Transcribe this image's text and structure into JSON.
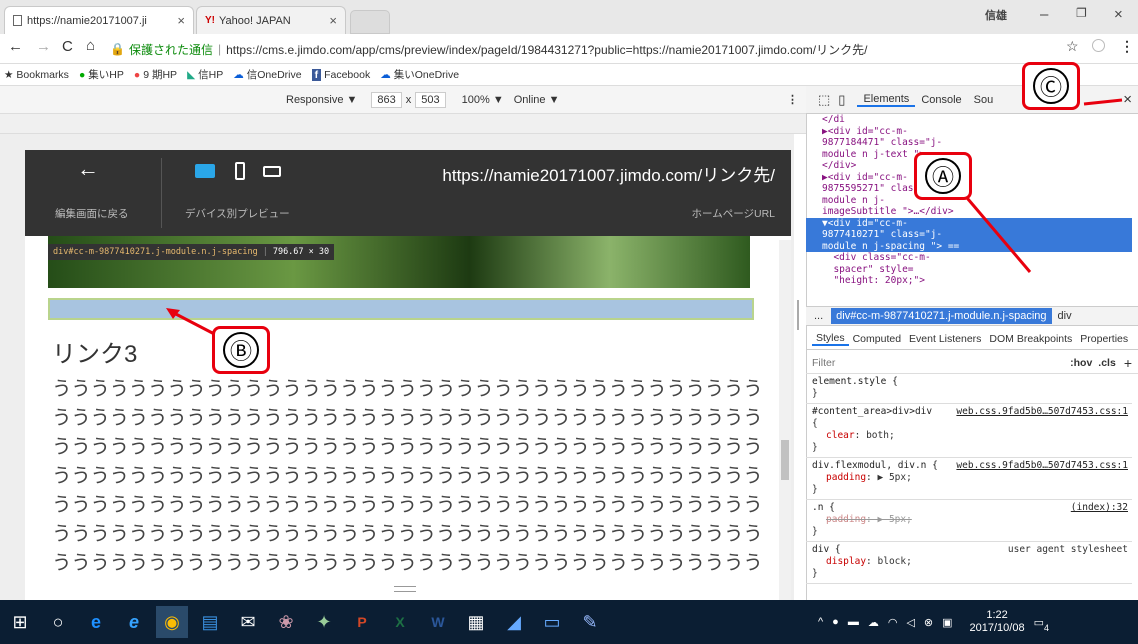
{
  "browser": {
    "tabs": [
      {
        "title": "https://namie20171007.ji",
        "favicon": "page-icon"
      },
      {
        "title": "Yahoo! JAPAN",
        "favicon": "yahoo-icon"
      }
    ],
    "window_user": "信雄",
    "security_label": "保護された通信",
    "url": "https://cms.e.jimdo.com/app/cms/preview/index/pageId/1984431271?public=https://namie20171007.jimdo.com/リンク先/"
  },
  "bookmarks": [
    "Bookmarks",
    "集いHP",
    "9 期HP",
    "信HP",
    "信OneDrive",
    "Facebook",
    "集いOneDrive"
  ],
  "device_toolbar": {
    "mode": "Responsive ▼",
    "width": "863",
    "times": "x",
    "height": "503",
    "zoom": "100% ▼",
    "network": "Online ▼"
  },
  "jimdo_header": {
    "back_label": "編集画面に戻る",
    "preview_label": "デバイス別プレビュー",
    "url": "https://namie20171007.jimdo.com/リンク先/",
    "url_label": "ホームページURL"
  },
  "inspect_tooltip": {
    "selector": "div#cc-m-9877410271.j-module.n.j-spacing",
    "size": "796.67 × 30"
  },
  "page": {
    "heading": "リンク3",
    "lines": [
      "ううううううううううううううううううううううううううううううううううううう",
      "ううううううううううううううううううううううううううううううううううううう",
      "ううううううううううううううううううううううううううううううううううううう",
      "ううううううううううううううううううううううううううううううううううううう",
      "ううううううううううううううううううううううううううううううううううううう",
      "ううううううううううううううううううううううううううううううううううううう",
      "ううううううううううううううううううううううううううううううううううううう"
    ]
  },
  "devtools": {
    "tabs": [
      "Elements",
      "Console",
      "Sou"
    ],
    "dom_lines": [
      "</di",
      "▶<div id=\"cc-m-",
      "9877184471\" class=\"j-",
      "module n j-text \">…",
      "</div>",
      "▶<div id=\"cc-m-",
      "9875595271\" class=\"j-",
      "module n j-",
      "imageSubtitle \">…</div>",
      "▼<div id=\"cc-m-",
      "9877410271\" class=\"j-",
      "module n j-spacing \"> ==",
      "  <div class=\"cc-m-",
      "  spacer\" style=",
      "  \"height: 20px;\">"
    ],
    "selected_dom_lines": [
      9,
      10,
      11
    ],
    "breadcrumb": [
      "...",
      "div#cc-m-9877410271.j-module.n.j-spacing",
      "div"
    ],
    "style_tabs": [
      "Styles",
      "Computed",
      "Event Listeners",
      "DOM Breakpoints",
      "Properties"
    ],
    "filter_placeholder": "Filter",
    "filter_hov": ":hov",
    "filter_cls": ".cls",
    "filter_plus": "+",
    "rules": [
      {
        "selector": "element.style {",
        "source": "",
        "props": [],
        "close": "}"
      },
      {
        "selector": "#content_area>div>div",
        "source": "web.css.9fad5b0…507d7453.css:1",
        "open": "{",
        "props": [
          {
            "name": "clear",
            "value": "both;",
            "struck": false
          }
        ],
        "close": "}"
      },
      {
        "selector": "div.flexmodul, div.n {",
        "source": "web.css.9fad5b0…507d7453.css:1",
        "props": [
          {
            "name": "padding",
            "value": "▶ 5px;",
            "struck": false
          }
        ],
        "close": "}"
      },
      {
        "selector": ".n {",
        "source": "(index):32",
        "props": [
          {
            "name": "padding",
            "value": "▶ 5px;",
            "struck": true
          }
        ],
        "close": "}"
      },
      {
        "selector": "div {",
        "source": "user agent stylesheet",
        "props": [
          {
            "name": "display",
            "value": "block;",
            "struck": false
          }
        ],
        "close": "}"
      }
    ]
  },
  "annotations": {
    "a": "Ⓐ",
    "b": "Ⓑ",
    "c": "Ⓒ"
  },
  "taskbar": {
    "clock_time": "1:22",
    "clock_date": "2017/10/08",
    "notification_count": "4"
  },
  "colors": {
    "selection": "#3879d9",
    "callout_border": "#e8000e",
    "taskbar": "#0b1e33"
  }
}
